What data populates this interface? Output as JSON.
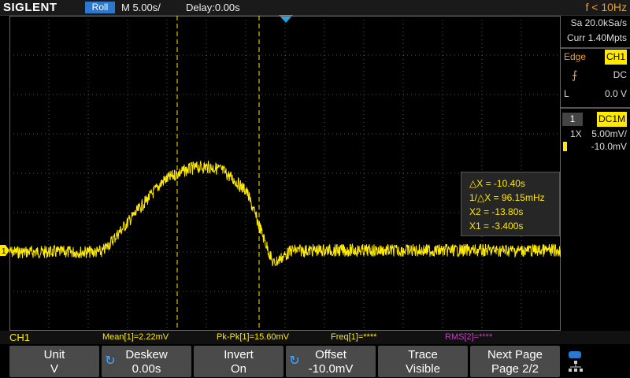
{
  "topbar": {
    "brand": "SIGLENT",
    "mode": "Roll",
    "timebase": "M 5.00s/",
    "delay": "Delay:0.00s",
    "frequency": "f < 10Hz"
  },
  "acquisition": {
    "sample_rate": "Sa 20.0kSa/s",
    "memory_depth": "Curr 1.40Mpts"
  },
  "trigger": {
    "type": "Edge",
    "source": "CH1",
    "coupling": "DC",
    "level_label": "L",
    "level": "0.0 V"
  },
  "channel": {
    "number": "1",
    "coupling": "DC1M",
    "probe": "1X",
    "scale": "5.00mV/",
    "offset": "-10.0mV"
  },
  "cursors": {
    "delta_x": "△X = -10.40s",
    "inv_delta_x": "1/△X = 96.15mHz",
    "x2": "X2 = -13.80s",
    "x1": "X1 = -3.400s"
  },
  "measurements": {
    "channel": "CH1",
    "mean": "Mean[1]=2.22mV",
    "pkpk": "Pk-Pk[1]=15.60mV",
    "freq": "Freq[1]=****",
    "rms": "RMS[2]=****"
  },
  "ground_marker": "1",
  "softkeys": [
    {
      "label": "Unit",
      "value": "V"
    },
    {
      "label": "Deskew",
      "value": "0.00s"
    },
    {
      "label": "Invert",
      "value": "On"
    },
    {
      "label": "Offset",
      "value": "-10.0mV"
    },
    {
      "label": "Trace",
      "value": "Visible"
    },
    {
      "label": "Next Page",
      "value": "Page 2/2"
    }
  ],
  "colors": {
    "trace": "#ffea00",
    "accent": "#f0a020",
    "trigger_marker": "#29a3e0",
    "rms": "#c040c0"
  }
}
